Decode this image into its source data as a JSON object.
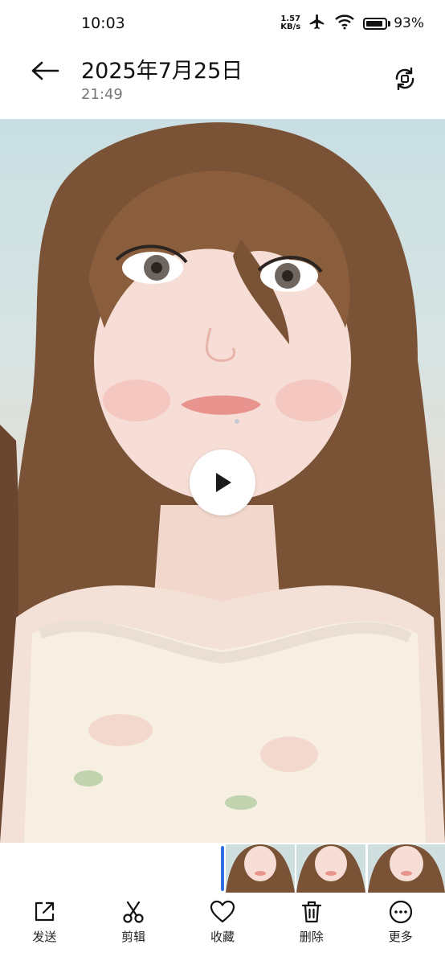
{
  "status_bar": {
    "time": "10:03",
    "net_speed_value": "1.57",
    "net_speed_unit": "KB/s",
    "battery_percent": "93%",
    "battery_level": 0.93
  },
  "header": {
    "date": "2025年7月25日",
    "time": "21:49"
  },
  "toolbar": {
    "items": [
      {
        "label": "发送",
        "icon": "share-icon"
      },
      {
        "label": "剪辑",
        "icon": "scissors-icon"
      },
      {
        "label": "收藏",
        "icon": "heart-icon"
      },
      {
        "label": "删除",
        "icon": "trash-icon"
      },
      {
        "label": "更多",
        "icon": "more-icon"
      }
    ]
  },
  "colors": {
    "accent": "#2f6fe0",
    "text_primary": "#111111",
    "text_secondary": "#777777"
  }
}
